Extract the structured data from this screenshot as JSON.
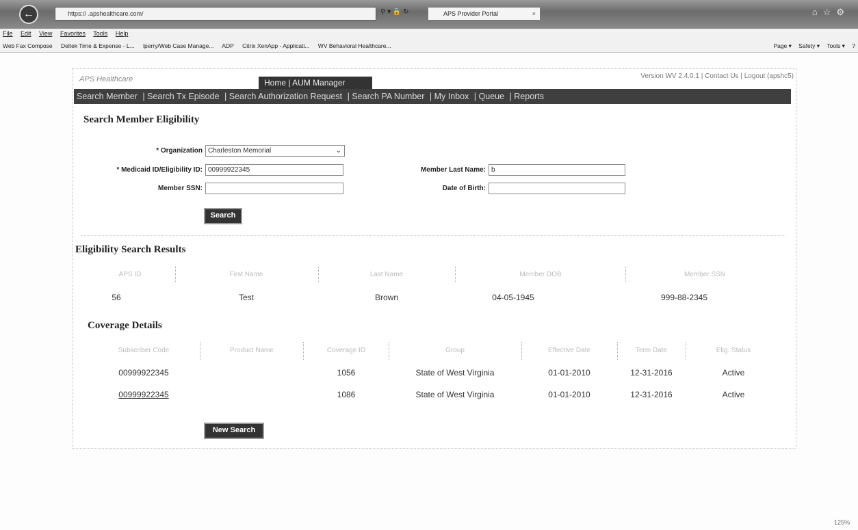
{
  "browser": {
    "url": "https://                 .apshealthcare.com/",
    "tab_title": "APS Provider Portal",
    "menu": [
      "File",
      "Edit",
      "View",
      "Favorites",
      "Tools",
      "Help"
    ],
    "favorites": [
      "Web Fax Compose",
      "Deltek Time & Expense - L...",
      "lperry/Web Case Manage...",
      "ADP",
      "Citrix XenApp - Applicati...",
      "WV Behavioral Healthcare..."
    ],
    "commands": [
      "Page ▾",
      "Safety ▾",
      "Tools ▾",
      "?"
    ],
    "zoom": "125%"
  },
  "header": {
    "logo": "APS Healthcare",
    "home_bar": "Home | AUM Manager",
    "top_right": "Version WV 2.4.0.1 | Contact Us | Logout (apshc5)"
  },
  "nav": {
    "items": [
      "Search Member",
      "Search Tx Episode",
      "Search Authorization Request",
      "Search PA Number",
      "My Inbox",
      "Queue",
      "Reports"
    ]
  },
  "search": {
    "title": "Search Member Eligibility",
    "organization_label": "* Organization",
    "organization_value": "Charleston Memorial",
    "medicaid_label": "* Medicaid ID/Eligibility ID:",
    "medicaid_value": "00999922345",
    "ssn_label": "Member SSN:",
    "ssn_value": "",
    "last_name_label": "Member Last Name:",
    "last_name_value": "b",
    "dob_label": "Date of Birth:",
    "dob_value": "",
    "search_button": "Search"
  },
  "results": {
    "title": "Eligibility Search Results",
    "headers": [
      "APS ID",
      "First Name",
      "Last Name",
      "Member DOB",
      "Member SSN"
    ],
    "row": [
      "56",
      "Test",
      "Brown",
      "04-05-1945",
      "999-88-2345"
    ]
  },
  "coverage": {
    "title": "Coverage Details",
    "headers": [
      "Subscriber Code",
      "Product Name",
      "Coverage ID",
      "Group",
      "Effective Date",
      "Term Date",
      "Elig. Status"
    ],
    "rows": [
      [
        "00999922345",
        "",
        "1056",
        "State of West Virginia",
        "01-01-2010",
        "12-31-2016",
        "Active"
      ],
      [
        "00999922345",
        "",
        "1086",
        "State of West Virginia",
        "01-01-2010",
        "12-31-2016",
        "Active"
      ]
    ],
    "new_search_button": "New Search"
  }
}
